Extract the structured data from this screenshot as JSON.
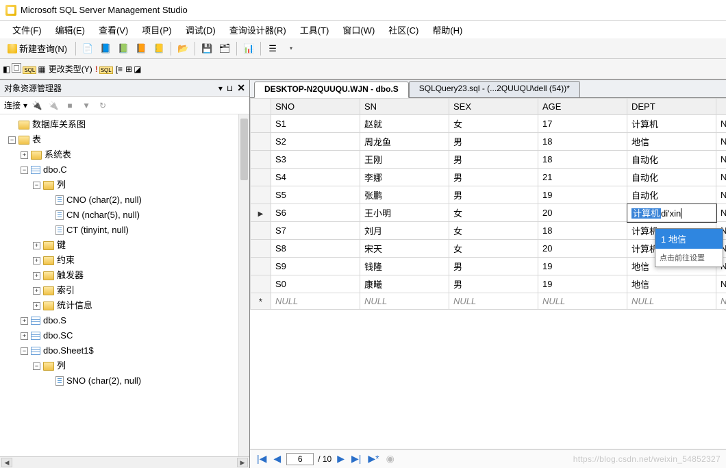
{
  "app": {
    "title": "Microsoft SQL Server Management Studio"
  },
  "menu": {
    "file": "文件(F)",
    "edit": "编辑(E)",
    "view": "查看(V)",
    "project": "项目(P)",
    "debug": "调试(D)",
    "querydesigner": "查询设计器(R)",
    "tools": "工具(T)",
    "window": "窗口(W)",
    "community": "社区(C)",
    "help": "帮助(H)"
  },
  "toolbar": {
    "newquery": "新建查询(N)",
    "changetype": "更改类型(Y)"
  },
  "panel": {
    "title": "对象资源管理器",
    "connect": "连接"
  },
  "tree": {
    "diagrams": "数据库关系图",
    "tables": "表",
    "systables": "系统表",
    "dboC": "dbo.C",
    "columns": "列",
    "col_cno": "CNO (char(2), null)",
    "col_cn": "CN (nchar(5), null)",
    "col_ct": "CT (tinyint, null)",
    "keys": "键",
    "constraints": "约束",
    "triggers": "触发器",
    "indexes": "索引",
    "stats": "统计信息",
    "dboS": "dbo.S",
    "dboSC": "dbo.SC",
    "dboSheet1": "dbo.Sheet1$",
    "col_sno": "SNO (char(2), null)"
  },
  "tabs": {
    "active": "DESKTOP-N2QUUQU.WJN - dbo.S",
    "other": "SQLQuery23.sql - (...2QUUQU\\dell (54))*"
  },
  "grid": {
    "headers": [
      "SNO",
      "SN",
      "SEX",
      "AGE",
      "DEPT"
    ],
    "rows": [
      {
        "sno": "S1",
        "sn": "赵就",
        "sex": "女",
        "age": "17",
        "dept": "计算机"
      },
      {
        "sno": "S2",
        "sn": "周龙鱼",
        "sex": "男",
        "age": "18",
        "dept": "地信"
      },
      {
        "sno": "S3",
        "sn": "王刚",
        "sex": "男",
        "age": "18",
        "dept": "自动化"
      },
      {
        "sno": "S4",
        "sn": "李娜",
        "sex": "男",
        "age": "21",
        "dept": "自动化"
      },
      {
        "sno": "S5",
        "sn": "张鹏",
        "sex": "男",
        "age": "19",
        "dept": "自动化"
      },
      {
        "sno": "S6",
        "sn": "王小明",
        "sex": "女",
        "age": "20",
        "dept_sel": "计算机",
        "dept_typed": "di'xin"
      },
      {
        "sno": "S7",
        "sn": "刘月",
        "sex": "女",
        "age": "18",
        "dept": "计算机"
      },
      {
        "sno": "S8",
        "sn": "宋天",
        "sex": "女",
        "age": "20",
        "dept": "计算机"
      },
      {
        "sno": "S9",
        "sn": "钱隆",
        "sex": "男",
        "age": "19",
        "dept": "地信"
      },
      {
        "sno": "S0",
        "sn": "康曦",
        "sex": "男",
        "age": "19",
        "dept": "地信"
      }
    ],
    "null": "NULL",
    "extra_n": "N"
  },
  "ime": {
    "candidate_num": "1",
    "candidate": "地信",
    "hint": "点击前往设置"
  },
  "nav": {
    "pos": "6",
    "total": "/ 10",
    "watermark": "https://blog.csdn.net/weixin_54852327"
  }
}
